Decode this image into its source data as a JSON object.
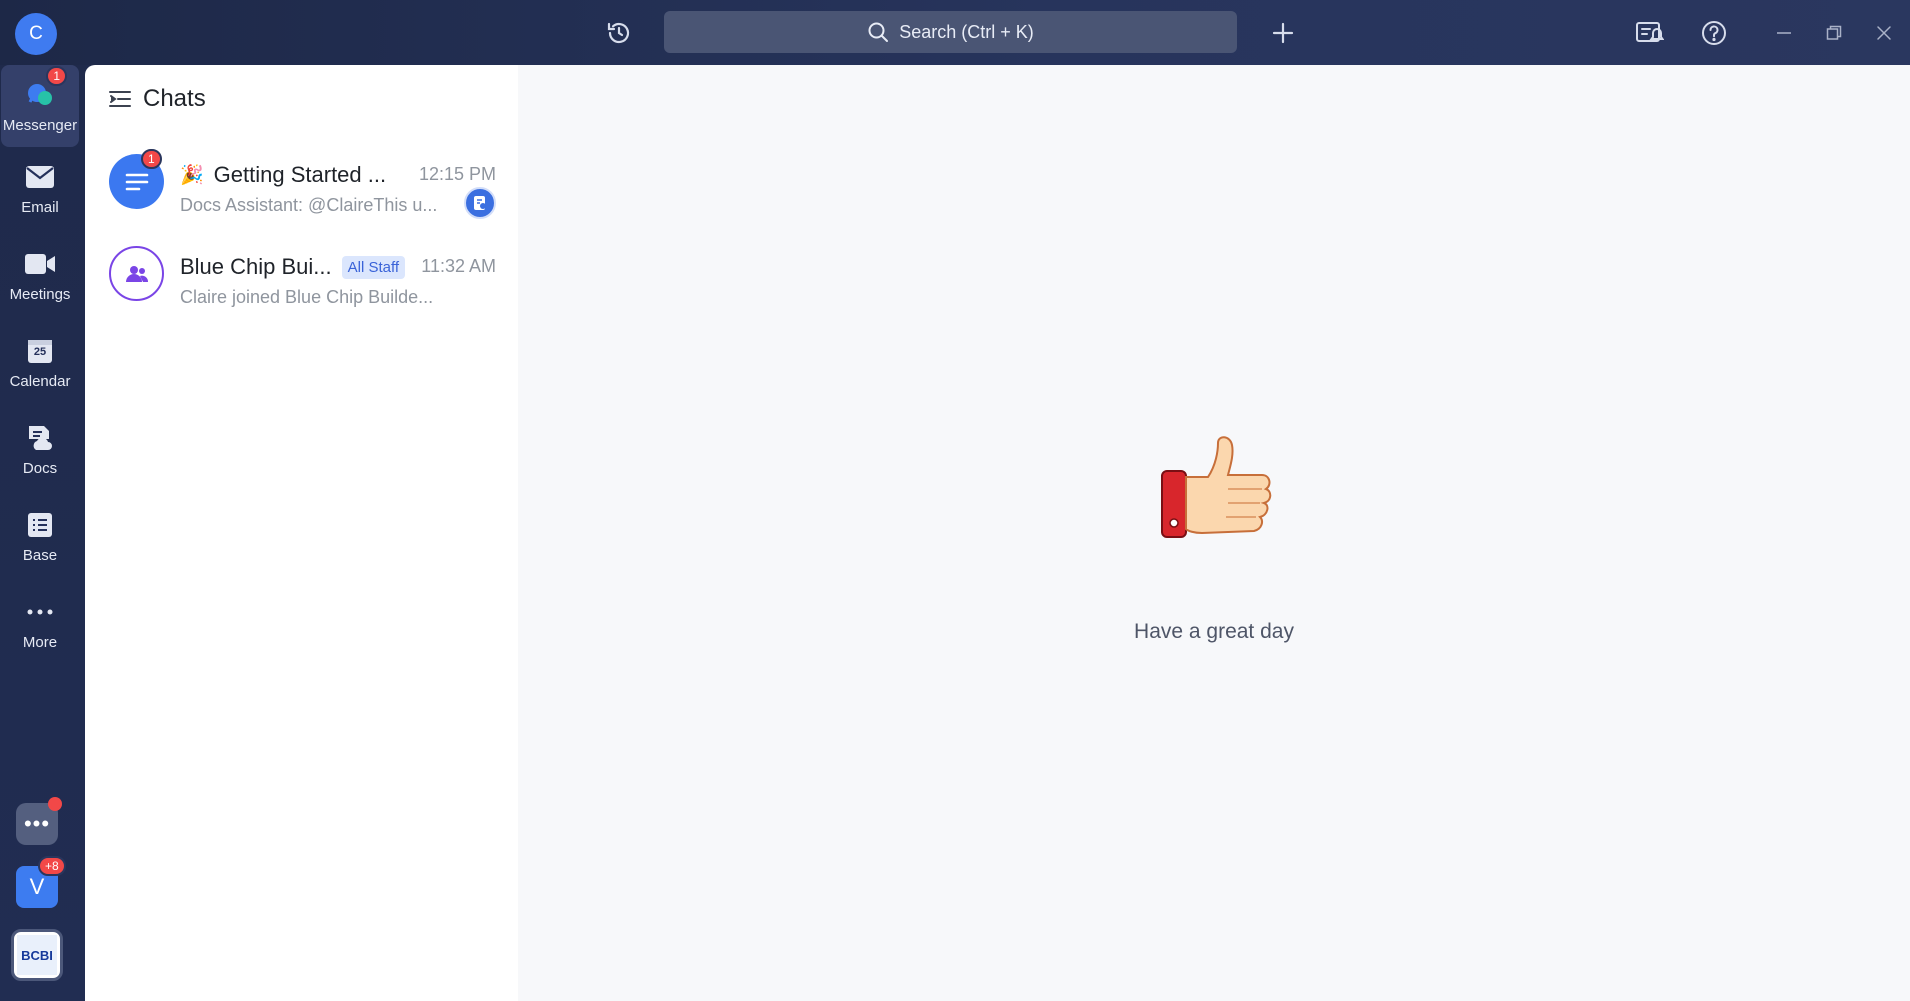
{
  "topbar": {
    "user_initial": "C",
    "search_placeholder": "Search (Ctrl + K)"
  },
  "rail": {
    "items": [
      {
        "label": "Messenger",
        "icon": "messenger-icon",
        "badge": "1"
      },
      {
        "label": "Email",
        "icon": "mail-icon"
      },
      {
        "label": "Meetings",
        "icon": "video-icon"
      },
      {
        "label": "Calendar",
        "icon": "calendar-icon",
        "day": "25"
      },
      {
        "label": "Docs",
        "icon": "docs-icon"
      },
      {
        "label": "Base",
        "icon": "base-icon"
      },
      {
        "label": "More",
        "icon": "more-icon"
      }
    ],
    "apps_tile": "•••",
    "workspace_initial": "V",
    "workspace_badge": "+8",
    "org_logo_text": "BCBI"
  },
  "chat_panel": {
    "title": "Chats",
    "chats": [
      {
        "emoji": "🎉",
        "name": "Getting Started ...",
        "time": "12:15 PM",
        "preview": "Docs Assistant: @ClaireThis u...",
        "badge": "1"
      },
      {
        "name": "Blue Chip Bui...",
        "tag": "All Staff",
        "time": "11:32 AM",
        "preview": "Claire joined Blue Chip Builde..."
      }
    ]
  },
  "main": {
    "greeting": "Have a great day"
  },
  "colors": {
    "topbar_bg": "#1d2847",
    "accent": "#3b78f0",
    "badge_red": "#f24848",
    "group_purple": "#7a45e6"
  }
}
